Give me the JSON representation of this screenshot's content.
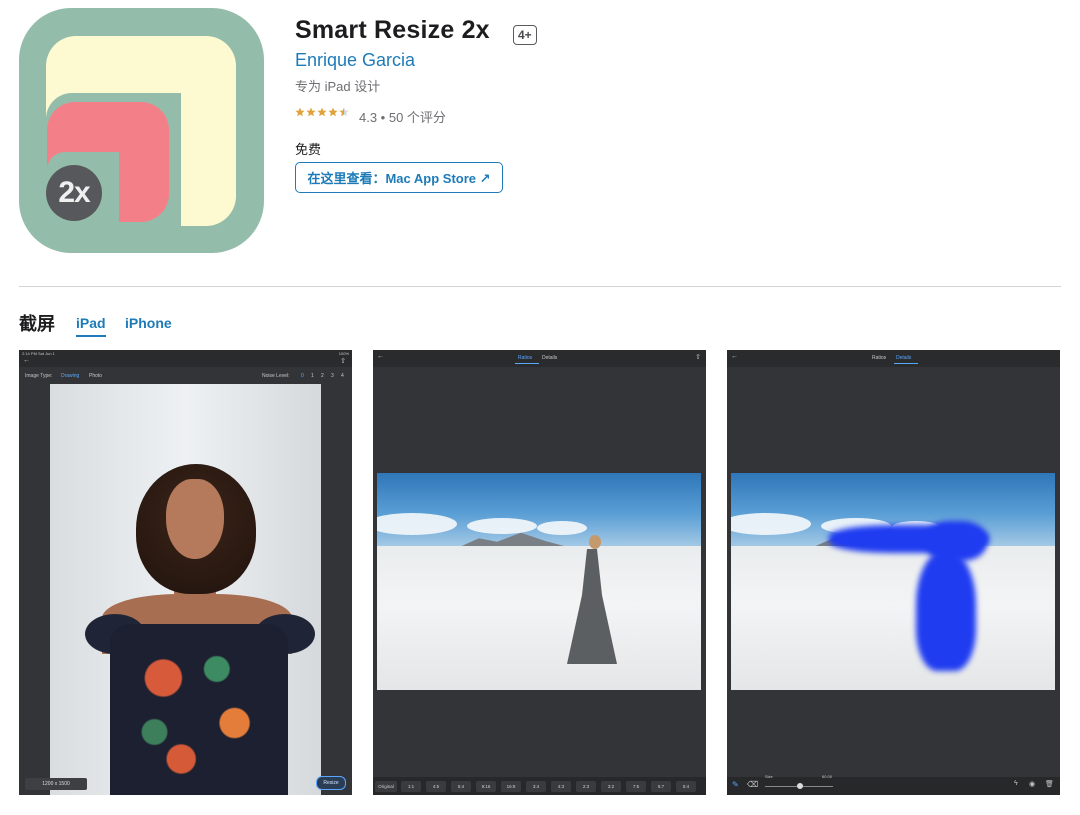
{
  "app": {
    "title": "Smart Resize 2x",
    "age_rating": "4+",
    "developer": "Enrique Garcia",
    "designed_for": "专为 iPad 设计",
    "rating": 4.3,
    "rating_text": "4.3 • 50 个评分",
    "price": "免费",
    "mac_store_button": "在这里查看：Mac App Store ↗",
    "icon_badge": "2x",
    "icon_colors": {
      "background": "#94bcaa",
      "yellow": "#fdf9d0",
      "pink": "#f38089",
      "badge": "#57585b"
    }
  },
  "screenshots_section": {
    "title": "截屏",
    "tabs": [
      {
        "label": "iPad",
        "active": true
      },
      {
        "label": "iPhone",
        "active": false
      }
    ]
  },
  "shot1": {
    "status_left": "2:14 PM   Sat Jun 1",
    "status_right": "100%",
    "image_type_label": "Image Type:",
    "image_type_options": [
      "Drawing",
      "Photo"
    ],
    "noise_level_label": "Noise Level:",
    "noise_levels": [
      "0",
      "1",
      "2",
      "3",
      "4"
    ],
    "size_label": "1200 x 1500",
    "resize_button": "Resize"
  },
  "shot2": {
    "tabs": [
      "Ratios",
      "Details"
    ],
    "ratios": [
      "Original",
      "1:1",
      "4:5",
      "5:4",
      "9:16",
      "16:9",
      "3:4",
      "4:3",
      "2:3",
      "3:2",
      "7:5",
      "5:7",
      "5:4"
    ]
  },
  "shot3": {
    "tabs": [
      "Ratios",
      "Details"
    ],
    "size_label": "Size",
    "size_value": "60.00"
  },
  "colors": {
    "accent": "#1e7bb8",
    "brush": "#1f3cf0"
  }
}
